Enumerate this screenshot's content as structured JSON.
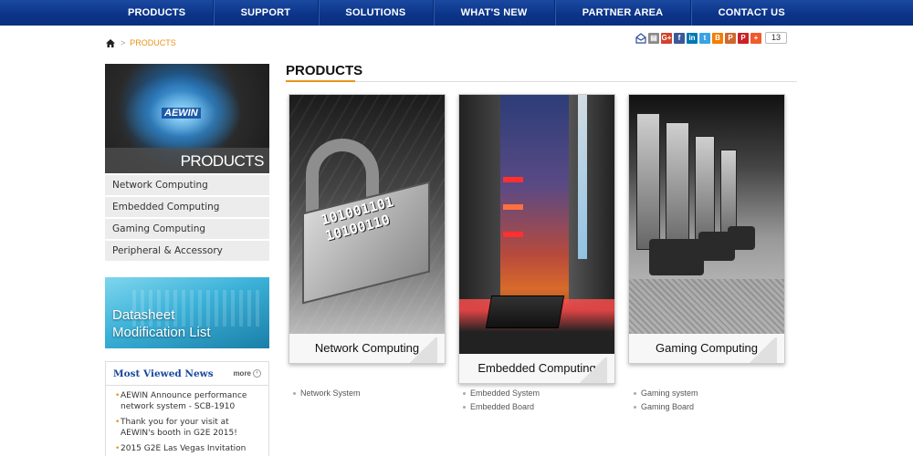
{
  "nav": {
    "items": [
      "PRODUCTS",
      "SUPPORT",
      "SOLUTIONS",
      "WHAT'S NEW",
      "PARTNER AREA",
      "CONTACT US"
    ]
  },
  "breadcrumb": {
    "separator": ">",
    "current": "PRODUCTS"
  },
  "share": {
    "count": "13",
    "icons": [
      {
        "name": "email-icon",
        "glyph": "",
        "color": "#ffffff"
      },
      {
        "name": "print-icon",
        "glyph": "",
        "color": "#8a8a8a"
      },
      {
        "name": "google-plus-icon",
        "glyph": "G+",
        "color": "#d0432f"
      },
      {
        "name": "facebook-icon",
        "glyph": "f",
        "color": "#3b5998"
      },
      {
        "name": "linkedin-icon",
        "glyph": "in",
        "color": "#0077b5"
      },
      {
        "name": "twitter-icon",
        "glyph": "t",
        "color": "#3aa3e3"
      },
      {
        "name": "blogger-icon",
        "glyph": "B",
        "color": "#f57d00"
      },
      {
        "name": "plurk-icon",
        "glyph": "P",
        "color": "#cf682f"
      },
      {
        "name": "pinterest-icon",
        "glyph": "P",
        "color": "#cb2027"
      },
      {
        "name": "more-share-icon",
        "glyph": "+",
        "color": "#f05b2b"
      }
    ]
  },
  "sidebar": {
    "banner_label": "PRODUCTS",
    "banner_brand": "AEWIN",
    "categories": [
      "Network Computing",
      "Embedded Computing",
      "Gaming Computing",
      "Peripheral & Accessory"
    ],
    "datasheet_line1": "Datasheet",
    "datasheet_line2": "Modification List"
  },
  "most_viewed": {
    "title": "Most Viewed News",
    "more": "more",
    "items": [
      "AEWIN Announce performance network system - SCB-1910",
      "Thank you for your visit at AEWIN's booth in G2E 2015!",
      "2015 G2E Las Vegas Invitation"
    ]
  },
  "main": {
    "title": "PRODUCTS",
    "cards": [
      {
        "caption": "Network Computing",
        "links": [
          "Network System"
        ]
      },
      {
        "caption": "Embedded Computing",
        "links": [
          "Embedded System",
          "Embedded Board"
        ]
      },
      {
        "caption": "Gaming Computing",
        "links": [
          "Gaming system",
          "Gaming Board"
        ]
      }
    ]
  },
  "colors": {
    "nav_blue": "#0b3388",
    "accent_orange": "#e8941a",
    "news_title_blue": "#17479c"
  }
}
